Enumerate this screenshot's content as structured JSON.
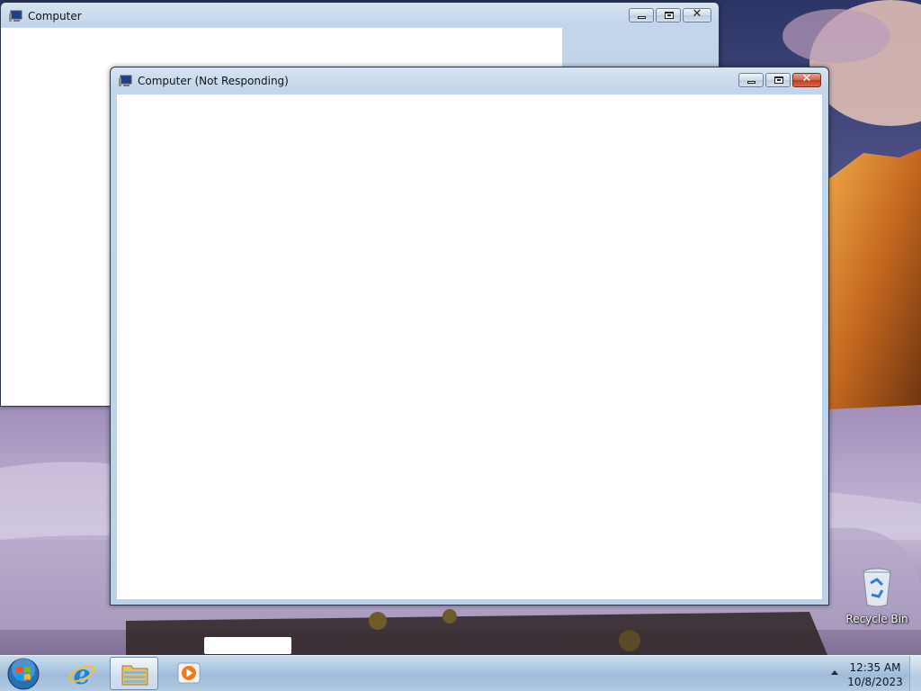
{
  "desktop": {
    "icons": [
      {
        "label": "Recycle Bin",
        "icon": "recycle-bin-icon"
      }
    ]
  },
  "windows": {
    "back": {
      "title": "Computer",
      "icon": "computer-icon"
    },
    "front": {
      "title": "Computer (Not Responding)",
      "icon": "computer-icon"
    }
  },
  "taskbar": {
    "start_icon": "windows-start-orb-icon",
    "pinned": [
      {
        "icon": "internet-explorer-icon",
        "active": false
      },
      {
        "icon": "file-explorer-folder-icon",
        "active": true
      },
      {
        "icon": "media-player-icon",
        "active": false
      }
    ],
    "tray": {
      "time": "12:35 AM",
      "date": "10/8/2023"
    }
  }
}
